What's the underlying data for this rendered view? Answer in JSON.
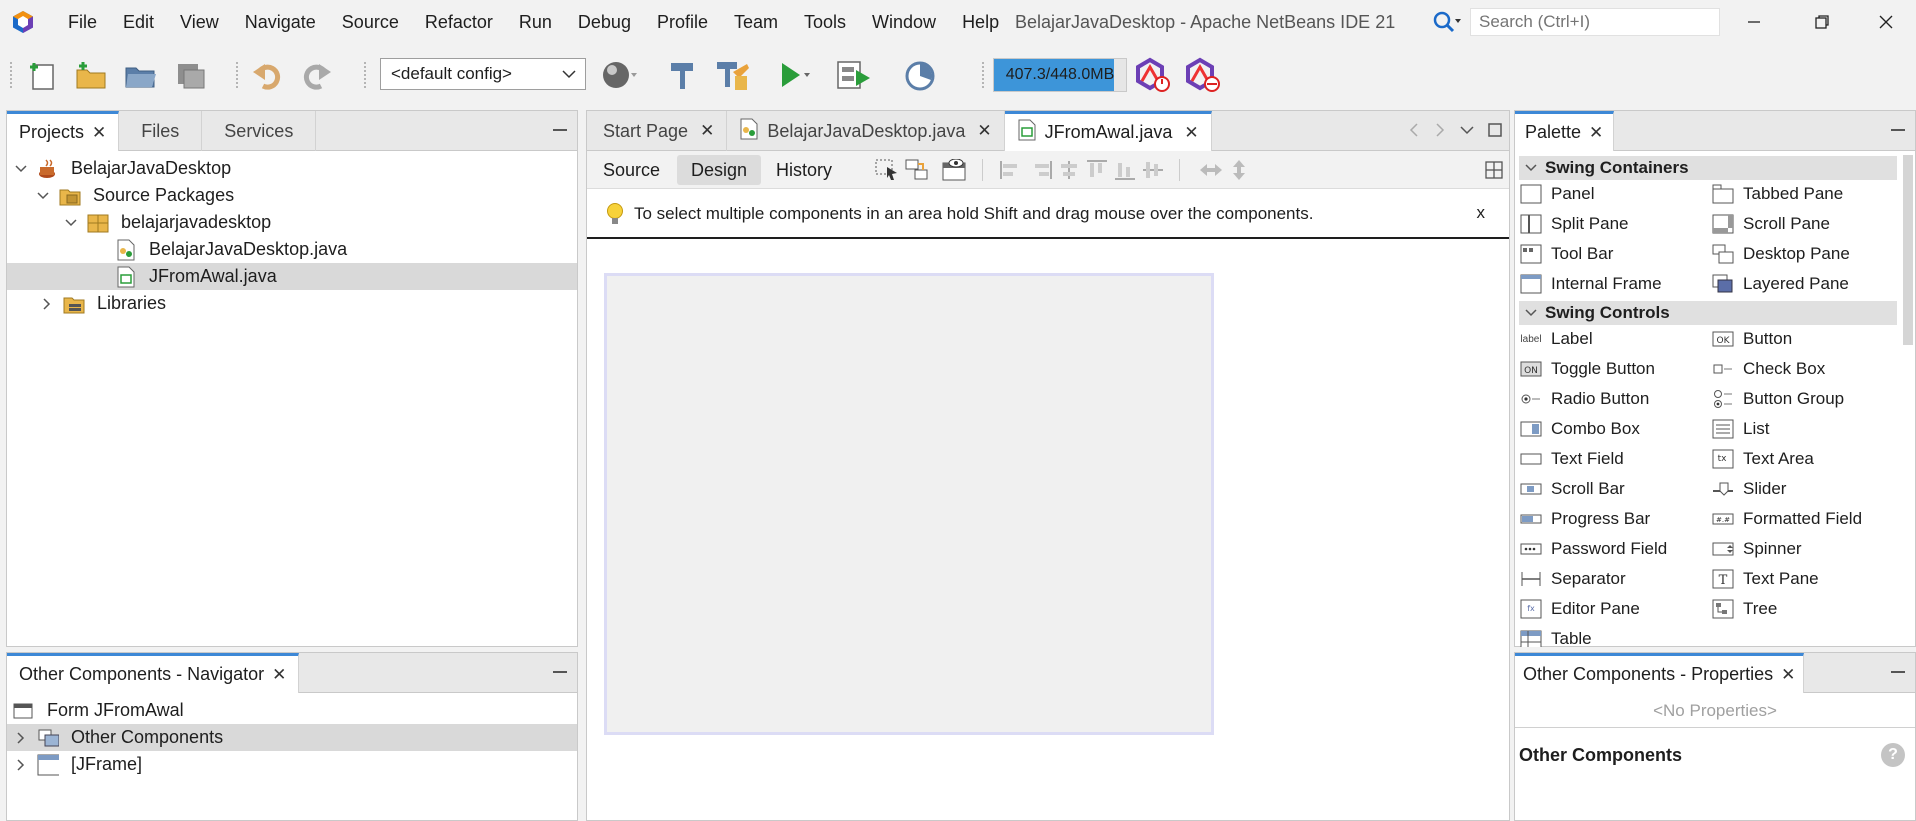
{
  "menubar": {
    "items": [
      "File",
      "Edit",
      "View",
      "Navigate",
      "Source",
      "Refactor",
      "Run",
      "Debug",
      "Profile",
      "Team",
      "Tools",
      "Window",
      "Help"
    ],
    "window_title": "BelajarJavaDesktop - Apache NetBeans IDE 21",
    "search_placeholder": "Search (Ctrl+I)"
  },
  "toolbar": {
    "config_value": "<default config>",
    "memory_text": "407.3/448.0MB",
    "memory_fraction": 0.909
  },
  "projects_panel": {
    "tabs": [
      "Projects",
      "Files",
      "Services"
    ],
    "tree": [
      {
        "label": "BelajarJavaDesktop",
        "level": 0,
        "expanded": true,
        "icon": "java-project-icon"
      },
      {
        "label": "Source Packages",
        "level": 1,
        "expanded": true,
        "icon": "source-packages-icon"
      },
      {
        "label": "belajarjavadesktop",
        "level": 2,
        "expanded": true,
        "icon": "package-icon"
      },
      {
        "label": "BelajarJavaDesktop.java",
        "level": 3,
        "icon": "java-form-file-icon"
      },
      {
        "label": "JFromAwal.java",
        "level": 3,
        "icon": "java-form-file-icon",
        "selected": true
      },
      {
        "label": "Libraries",
        "level": 1,
        "expanded": false,
        "icon": "libraries-icon"
      }
    ]
  },
  "navigator_panel": {
    "tab": "Other Components - Navigator",
    "tree": [
      {
        "label": "Form JFromAwal",
        "level": 0,
        "icon": "form-icon"
      },
      {
        "label": "Other Components",
        "level": 0,
        "expandable": true,
        "icon": "other-components-icon",
        "selected": true
      },
      {
        "label": "[JFrame]",
        "level": 0,
        "expandable": true,
        "icon": "jframe-icon"
      }
    ]
  },
  "editor": {
    "tabs": [
      {
        "label": "Start Page",
        "active": false
      },
      {
        "label": "BelajarJavaDesktop.java",
        "active": false
      },
      {
        "label": "JFromAwal.java",
        "active": true
      }
    ],
    "views": [
      "Source",
      "Design",
      "History"
    ],
    "active_view": "Design",
    "hint": "To select multiple components in an area hold Shift and drag mouse over the components.",
    "hint_close": "x"
  },
  "palette": {
    "tab": "Palette",
    "categories": [
      {
        "name": "Swing Containers",
        "items": [
          "Panel",
          "Tabbed Pane",
          "Split Pane",
          "Scroll Pane",
          "Tool Bar",
          "Desktop Pane",
          "Internal Frame",
          "Layered Pane"
        ]
      },
      {
        "name": "Swing Controls",
        "items": [
          "Label",
          "Button",
          "Toggle Button",
          "Check Box",
          "Radio Button",
          "Button Group",
          "Combo Box",
          "List",
          "Text Field",
          "Text Area",
          "Scroll Bar",
          "Slider",
          "Progress Bar",
          "Formatted Field",
          "Password Field",
          "Spinner",
          "Separator",
          "Text Pane",
          "Editor Pane",
          "Tree",
          "Table"
        ]
      }
    ]
  },
  "properties_panel": {
    "tab": "Other Components - Properties",
    "empty_text": "<No Properties>",
    "section_title": "Other Components",
    "help": "?"
  },
  "colors": {
    "accent": "#3d88d6",
    "memory_fill": "#3d95d9",
    "selection": "#d9d9d9"
  }
}
